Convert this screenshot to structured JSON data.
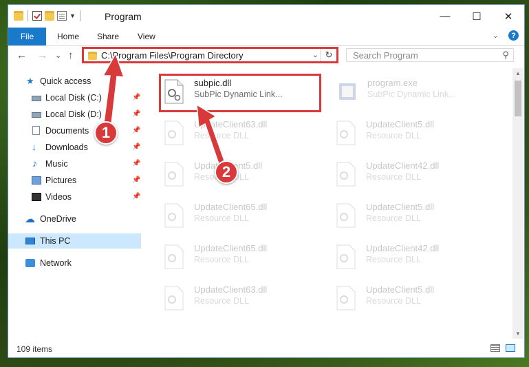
{
  "window": {
    "title": "Program",
    "controls": [
      "—",
      "☐",
      "✕"
    ]
  },
  "ribbon": {
    "file_label": "File",
    "tabs": [
      "Home",
      "Share",
      "View"
    ],
    "help_label": "?"
  },
  "navbar": {
    "back": "←",
    "forward": "→",
    "recent": "⌄",
    "up": "↑",
    "address_path": "C:\\Program Files\\Program Directory",
    "search_placeholder": "Search Program"
  },
  "sidebar": {
    "items": [
      {
        "label": "Quick access",
        "icon": "star-icon",
        "pinned": false
      },
      {
        "label": "Local Disk (C:)",
        "icon": "disk-icon",
        "pinned": true
      },
      {
        "label": "Local Disk (D:)",
        "icon": "disk-icon",
        "pinned": true
      },
      {
        "label": "Documents",
        "icon": "documents-icon",
        "pinned": true
      },
      {
        "label": "Downloads",
        "icon": "download-icon",
        "pinned": true
      },
      {
        "label": "Music",
        "icon": "music-icon",
        "pinned": true
      },
      {
        "label": "Pictures",
        "icon": "pictures-icon",
        "pinned": true
      },
      {
        "label": "Videos",
        "icon": "videos-icon",
        "pinned": true
      },
      {
        "label": "OneDrive",
        "icon": "cloud-icon",
        "pinned": false
      },
      {
        "label": "This PC",
        "icon": "computer-icon",
        "pinned": false,
        "selected": true
      },
      {
        "label": "Network",
        "icon": "network-icon",
        "pinned": false
      }
    ]
  },
  "files": [
    {
      "name": "subpic.dll",
      "desc": "SubPic Dynamic Link...",
      "highlighted": true
    },
    {
      "name": "program.exe",
      "desc": "SubPic Dynamic Link...",
      "faded": true
    },
    {
      "name": "UpdateClient63.dll",
      "desc": "Resource DLL",
      "faded": true
    },
    {
      "name": "UpdateClient5.dll",
      "desc": "Resource DLL",
      "faded": true
    },
    {
      "name": "UpdateClient5.dll",
      "desc": "Resource DLL",
      "faded": true
    },
    {
      "name": "UpdateClient42.dll",
      "desc": "Resource DLL",
      "faded": true
    },
    {
      "name": "UpdateClient65.dll",
      "desc": "Resource DLL",
      "faded": true
    },
    {
      "name": "UpdateClient5.dll",
      "desc": "Resource DLL",
      "faded": true
    },
    {
      "name": "UpdateClient65.dll",
      "desc": "Resource DLL",
      "faded": true
    },
    {
      "name": "UpdateClient42.dll",
      "desc": "Resource DLL",
      "faded": true
    },
    {
      "name": "UpdateClient63.dll",
      "desc": "Resource DLL",
      "faded": true
    },
    {
      "name": "UpdateClient5.dll",
      "desc": "Resource DLL",
      "faded": true
    }
  ],
  "status": {
    "item_count": "109 items"
  },
  "annotations": {
    "step1": "1",
    "step2": "2",
    "color": "#d8393b"
  }
}
